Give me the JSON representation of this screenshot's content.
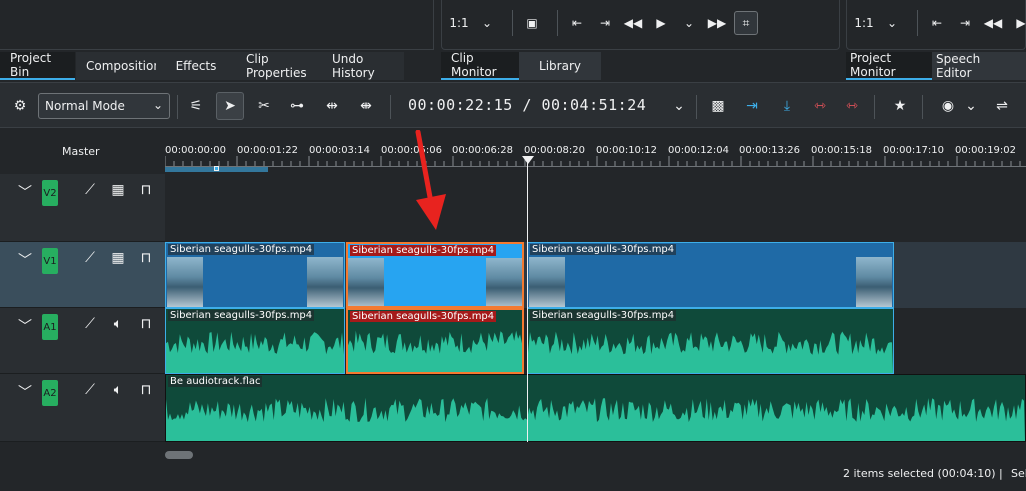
{
  "left_panel": {
    "tabs": [
      {
        "label": "Project Bin",
        "active": true
      },
      {
        "label": "Compositions",
        "active": false
      },
      {
        "label": "Effects",
        "active": false
      },
      {
        "label": "Clip Properties",
        "active": false
      },
      {
        "label": "Undo History",
        "active": false
      }
    ]
  },
  "clip_monitor": {
    "zoom": "1:1",
    "tabs": [
      {
        "label": "Clip Monitor",
        "active": true
      },
      {
        "label": "Library",
        "active": false
      }
    ]
  },
  "project_monitor": {
    "zoom": "1:1",
    "tabs": [
      {
        "label": "Project Monitor",
        "active": true
      },
      {
        "label": "Speech Editor",
        "active": false
      }
    ]
  },
  "toolbar": {
    "mode": "Normal Mode",
    "current_time": "00:00:22:15",
    "separator": "/",
    "total_time": "00:04:51:24"
  },
  "timeline": {
    "master_label": "Master",
    "ruler_labels": [
      "00:00:00:00",
      "00:00:01:22",
      "00:00:03:14",
      "00:00:05:06",
      "00:00:06:28",
      "00:00:08:20",
      "00:00:10:12",
      "00:00:12:04",
      "00:00:13:26",
      "00:00:15:18",
      "00:00:17:10",
      "00:00:19:02"
    ],
    "tracks": [
      {
        "name": "V2",
        "type": "video"
      },
      {
        "name": "V1",
        "type": "video"
      },
      {
        "name": "A1",
        "type": "audio"
      },
      {
        "name": "A2",
        "type": "audio"
      }
    ],
    "clips": {
      "v1": [
        "Siberian seagulls-30fps.mp4",
        "Siberian seagulls-30fps.mp4",
        "Siberian seagulls-30fps.mp4"
      ],
      "a1": [
        "Siberian seagulls-30fps.mp4",
        "Siberian seagulls-30fps.mp4",
        "Siberian seagulls-30fps.mp4"
      ],
      "a2": [
        "Be audiotrack.flac"
      ]
    }
  },
  "status": {
    "selection": "2 items selected (00:04:10)",
    "divider": "|",
    "extra": "Sel"
  },
  "colors": {
    "accent": "#3daee9",
    "selection_border": "#f47a30",
    "track_tag": "#27ae60",
    "waveform": "#2bbf9a",
    "arrow": "#e8231f"
  }
}
